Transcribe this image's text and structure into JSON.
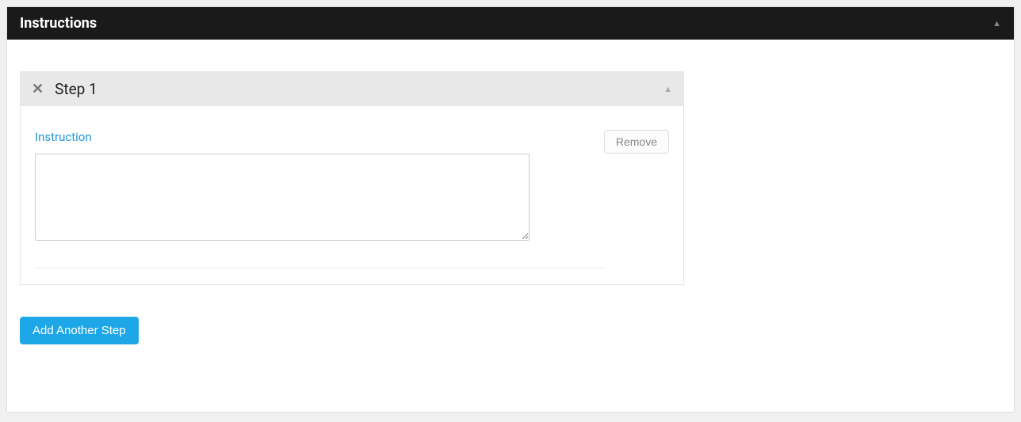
{
  "panel": {
    "title": "Instructions"
  },
  "steps": [
    {
      "title": "Step 1",
      "field_label": "Instruction",
      "value": "",
      "remove_label": "Remove"
    }
  ],
  "actions": {
    "add_step_label": "Add Another Step"
  }
}
